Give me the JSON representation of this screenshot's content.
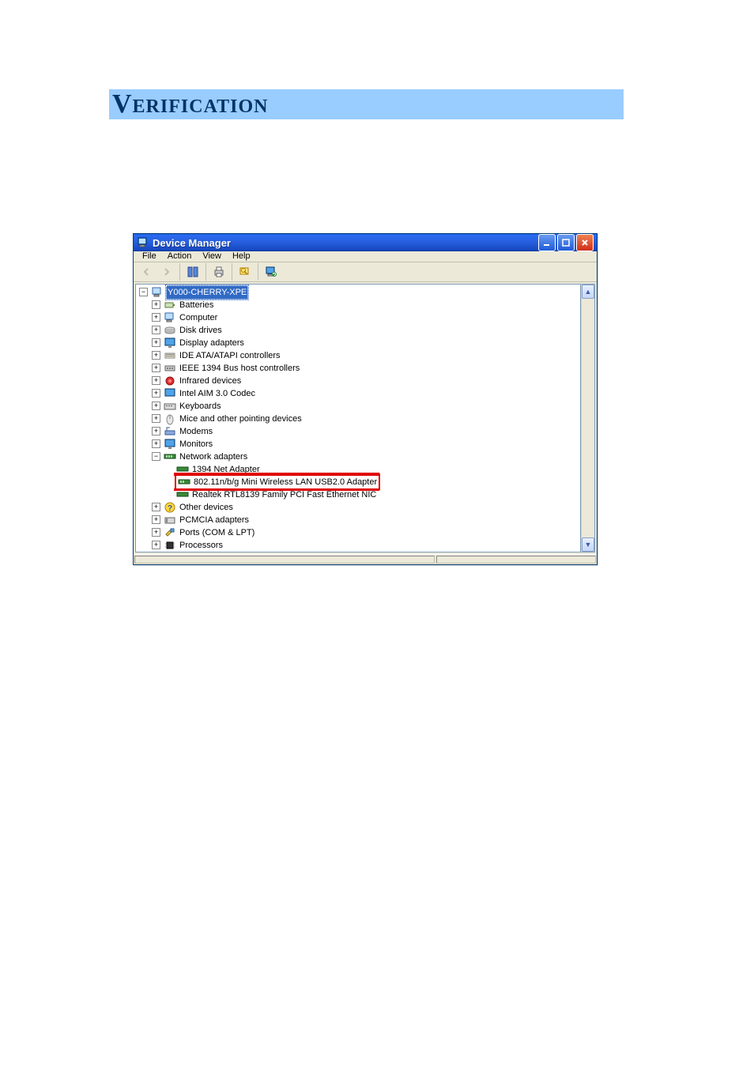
{
  "heading": "Verification",
  "window": {
    "title": "Device Manager",
    "menu": {
      "file": "File",
      "action": "Action",
      "view": "View",
      "help": "Help"
    },
    "btn": {
      "min": "_",
      "max": "□",
      "close": "×"
    }
  },
  "tree": {
    "root": "Y000-CHERRY-XPE",
    "items": [
      {
        "label": "Batteries",
        "icon": "battery"
      },
      {
        "label": "Computer",
        "icon": "computer"
      },
      {
        "label": "Disk drives",
        "icon": "disk"
      },
      {
        "label": "Display adapters",
        "icon": "display"
      },
      {
        "label": "IDE ATA/ATAPI controllers",
        "icon": "ide"
      },
      {
        "label": "IEEE 1394 Bus host controllers",
        "icon": "1394"
      },
      {
        "label": "Infrared devices",
        "icon": "infrared"
      },
      {
        "label": "Intel AIM 3.0 Codec",
        "icon": "codec"
      },
      {
        "label": "Keyboards",
        "icon": "keyboard"
      },
      {
        "label": "Mice and other pointing devices",
        "icon": "mouse"
      },
      {
        "label": "Modems",
        "icon": "modem"
      },
      {
        "label": "Monitors",
        "icon": "monitor"
      }
    ],
    "network": {
      "label": "Network adapters",
      "children": [
        "1394 Net Adapter",
        "802.11n/b/g Mini Wireless LAN USB2.0 Adapter",
        "Realtek RTL8139 Family PCI Fast Ethernet NIC"
      ]
    },
    "after": [
      {
        "label": "Other devices",
        "icon": "other"
      },
      {
        "label": "PCMCIA adapters",
        "icon": "pcmcia"
      },
      {
        "label": "Ports (COM & LPT)",
        "icon": "ports"
      },
      {
        "label": "Processors",
        "icon": "cpu"
      }
    ]
  }
}
